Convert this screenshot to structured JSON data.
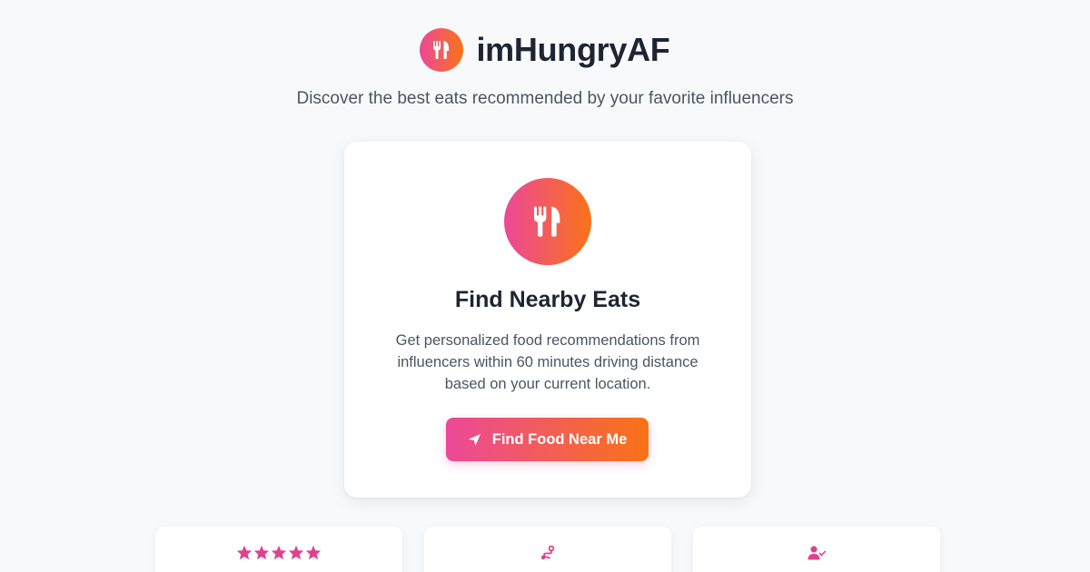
{
  "brand": {
    "name": "imHungryAF",
    "logo_icon": "utensils-icon"
  },
  "tagline": "Discover the best eats recommended by your favorite influencers",
  "card": {
    "icon": "utensils-icon",
    "title": "Find Nearby Eats",
    "description": "Get personalized food recommendations from influencers within 60 minutes driving distance based on your current location.",
    "button_label": "Find Food Near Me",
    "button_icon": "location-arrow-icon"
  },
  "features": [
    {
      "icon": "star-rating-icon",
      "stars": 5
    },
    {
      "icon": "route-icon"
    },
    {
      "icon": "user-check-icon"
    }
  ],
  "colors": {
    "gradient_start": "#ec4899",
    "gradient_end": "#f97316",
    "accent_pink": "#e0408f",
    "background": "#f8f9fb",
    "text_dark": "#1f2433",
    "text_muted": "#4b5563"
  }
}
